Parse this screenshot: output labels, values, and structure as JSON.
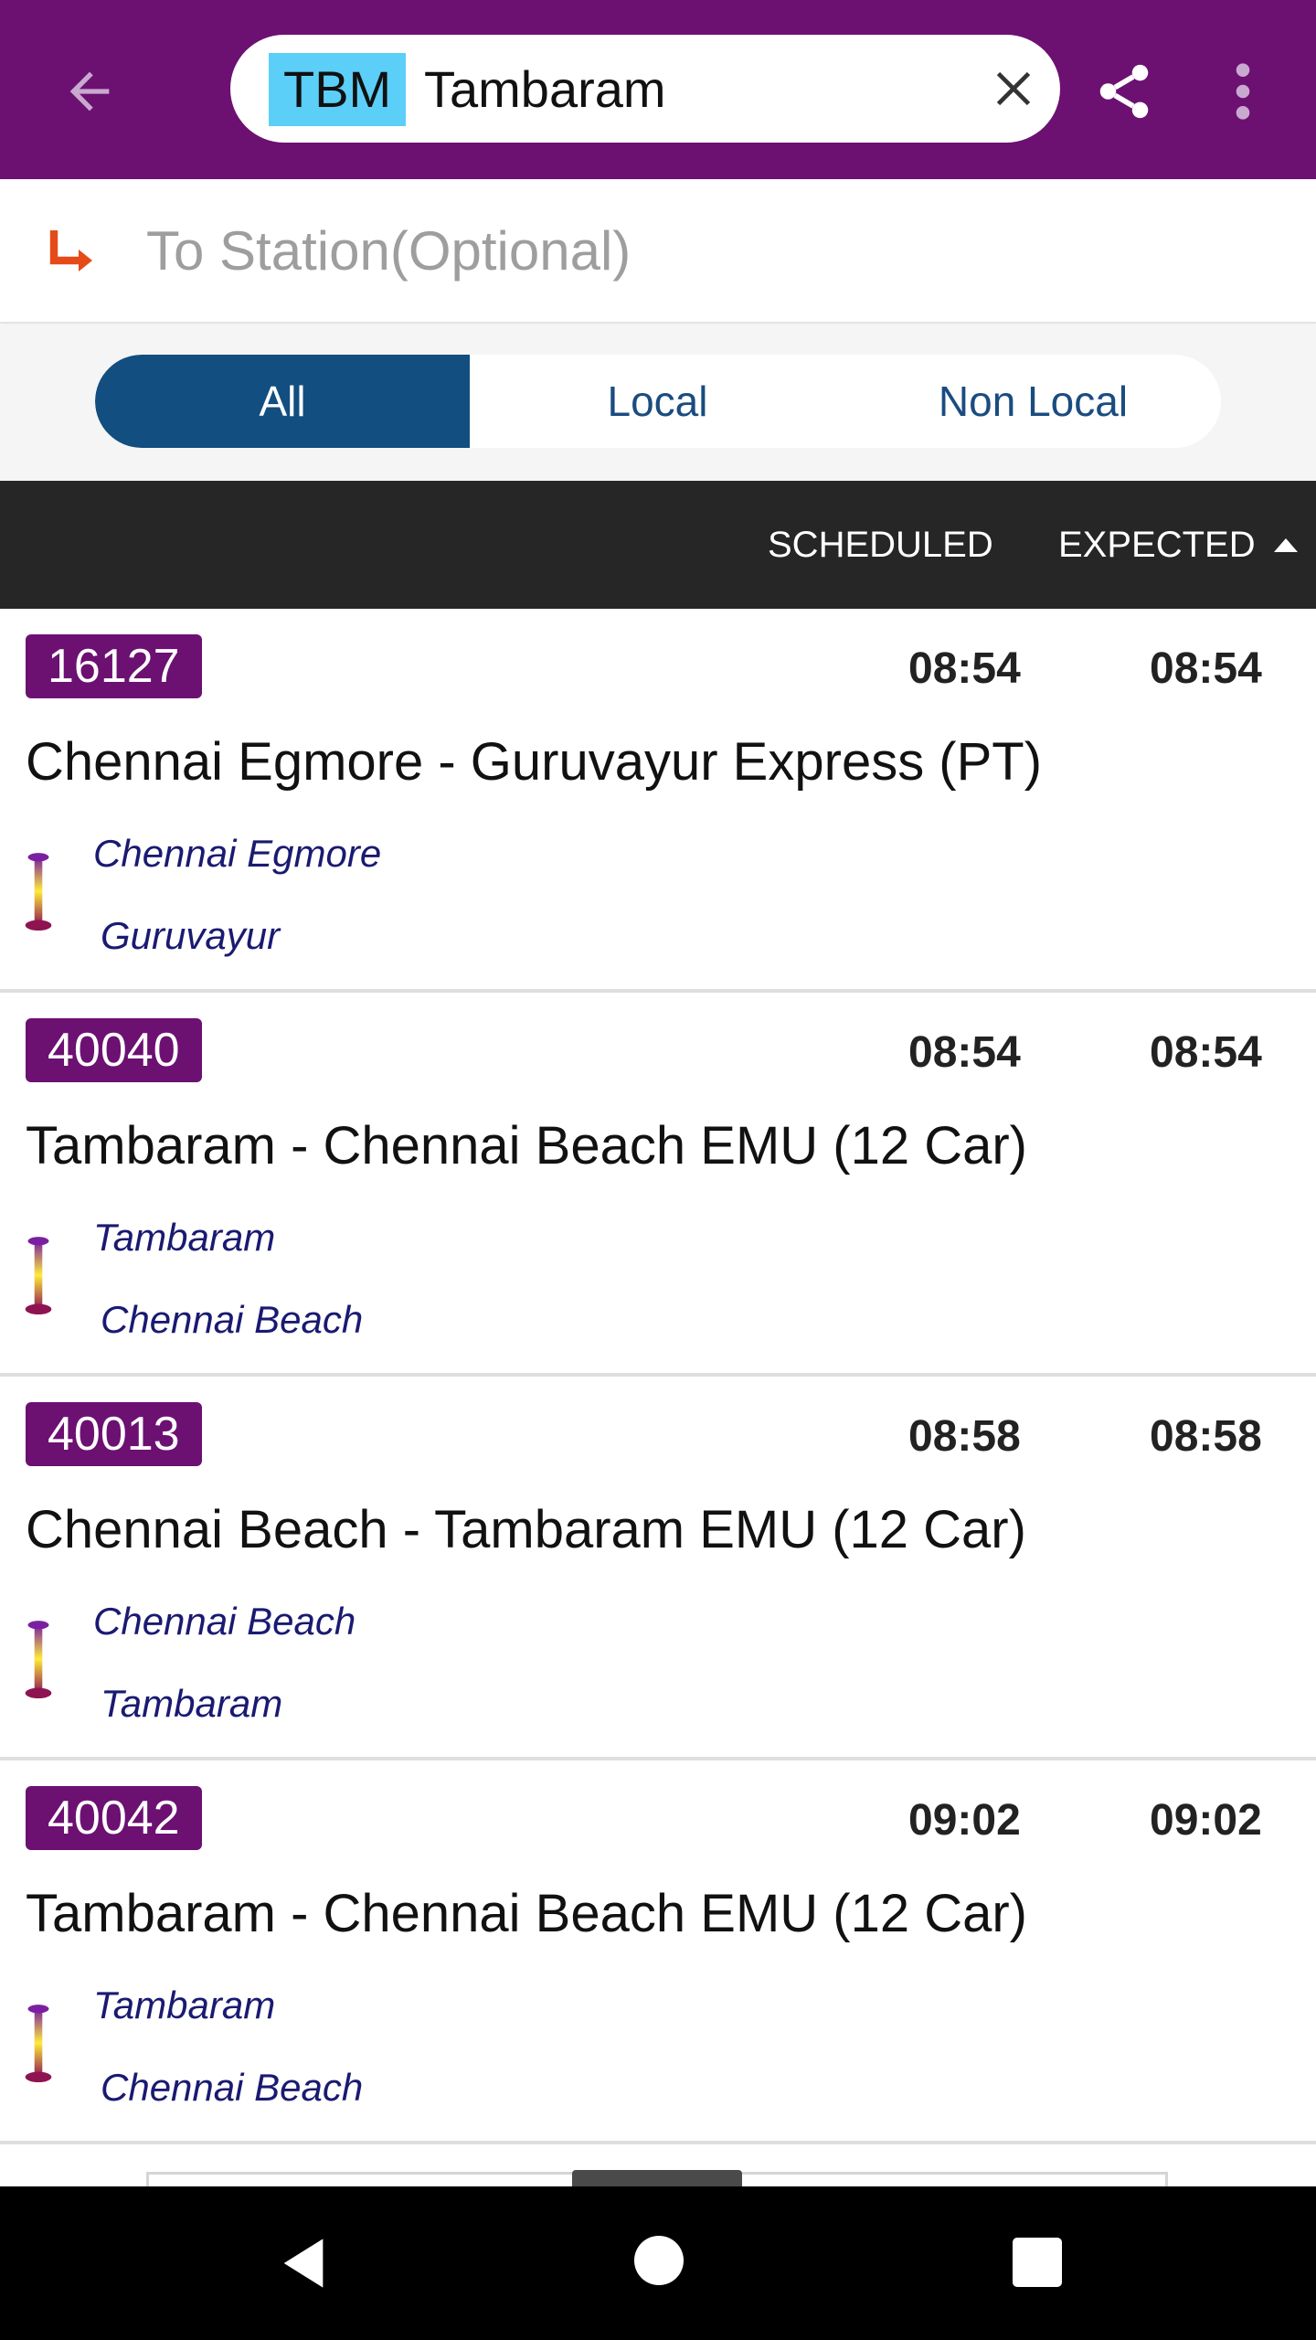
{
  "app_bar": {
    "station_code": "TBM",
    "station_name": "Tambaram",
    "color": "#6c1072"
  },
  "to_station": {
    "placeholder": "To Station(Optional)",
    "value": ""
  },
  "filter": {
    "options": [
      "All",
      "Local",
      "Non Local"
    ],
    "selected": "All"
  },
  "list_header": {
    "scheduled": "SCHEDULED",
    "expected": "EXPECTED",
    "sort": "ascending"
  },
  "trains": [
    {
      "number": "16127",
      "scheduled": "08:54",
      "expected": "08:54",
      "name": "Chennai Egmore - Guruvayur Express (PT)",
      "from": "Chennai Egmore",
      "to": "Guruvayur"
    },
    {
      "number": "40040",
      "scheduled": "08:54",
      "expected": "08:54",
      "name": "Tambaram - Chennai Beach EMU (12 Car)",
      "from": "Tambaram",
      "to": "Chennai Beach"
    },
    {
      "number": "40013",
      "scheduled": "08:58",
      "expected": "08:58",
      "name": "Chennai Beach - Tambaram EMU (12 Car)",
      "from": "Chennai Beach",
      "to": "Tambaram"
    },
    {
      "number": "40042",
      "scheduled": "09:02",
      "expected": "09:02",
      "name": "Tambaram - Chennai Beach EMU (12 Car)",
      "from": "Tambaram",
      "to": "Chennai Beach"
    }
  ],
  "icons": [
    "back-arrow-icon",
    "close-icon",
    "share-icon",
    "more-vert-icon",
    "turn-right-arrow-icon",
    "route-line-icon",
    "nav-back-icon",
    "nav-home-icon",
    "nav-recents-icon"
  ]
}
